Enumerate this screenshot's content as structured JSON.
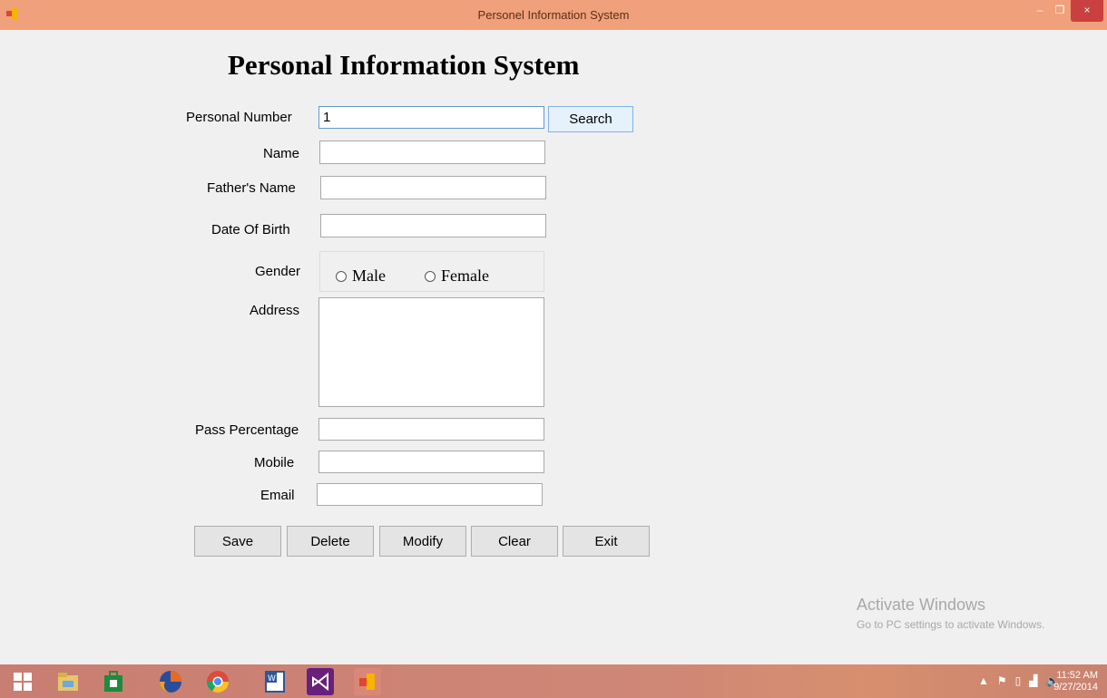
{
  "window": {
    "title": "Personel Information System",
    "minimize": "–",
    "maximize": "❐",
    "close": "×"
  },
  "form": {
    "heading": "Personal Information System",
    "personal_number_label": "Personal Number",
    "personal_number_value": "1",
    "search_label": "Search",
    "name_label": "Name",
    "fathers_name_label": "Father's Name",
    "dob_label": "Date Of Birth",
    "gender_label": "Gender",
    "gender_options": [
      "Male",
      "Female"
    ],
    "address_label": "Address",
    "pass_percentage_label": "Pass Percentage",
    "mobile_label": "Mobile",
    "email_label": "Email",
    "buttons": [
      "Save",
      "Delete",
      "Modify",
      "Clear",
      "Exit"
    ]
  },
  "watermark": {
    "line1": "Activate Windows",
    "line2": "Go to PC settings to activate Windows."
  },
  "taskbar": {
    "items": [
      "start-icon",
      "file-explorer-icon",
      "store-icon",
      "firefox-icon",
      "chrome-icon",
      "word-icon",
      "visual-studio-icon",
      "app-window-icon"
    ],
    "time": "11:52 AM",
    "date": "9/27/2014"
  },
  "colors": {
    "titlebar": "#f0a07a",
    "close_button": "#c94040",
    "taskbar": "#c87e72"
  }
}
